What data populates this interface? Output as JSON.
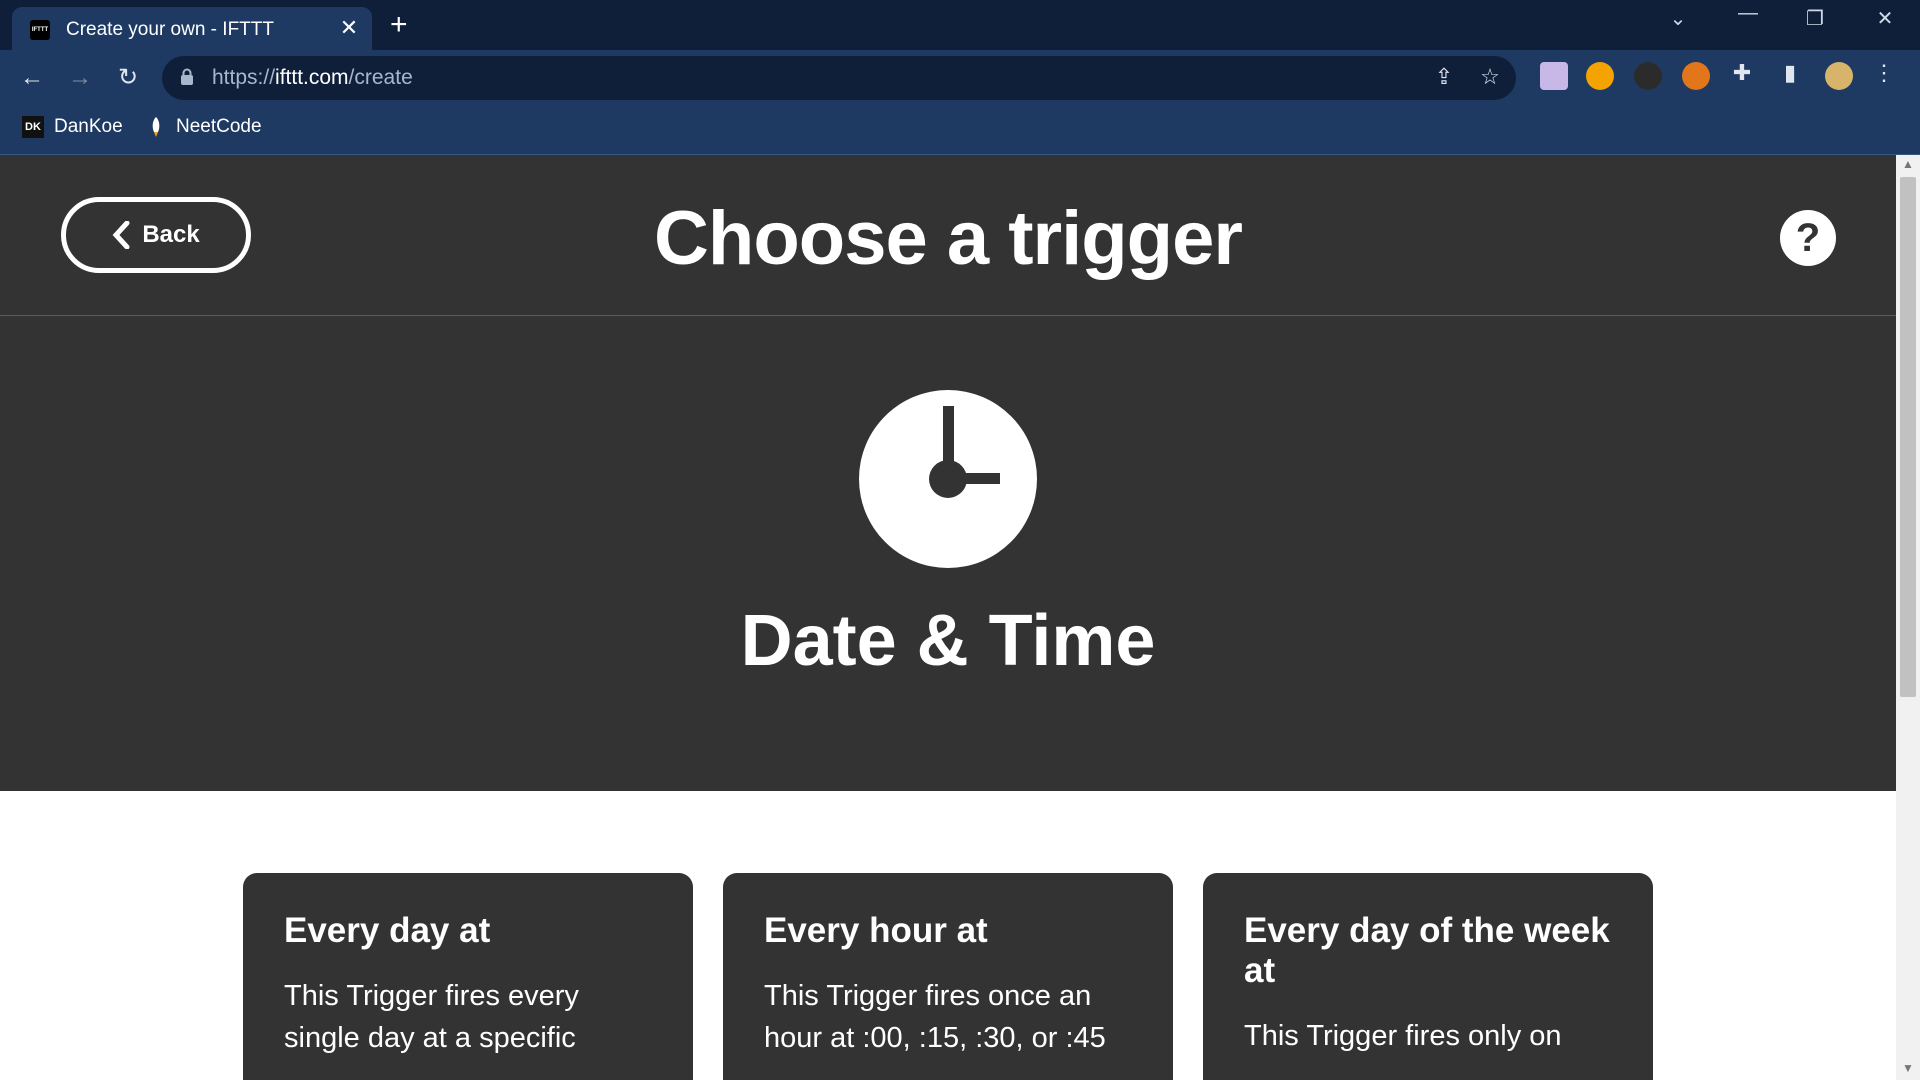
{
  "browser": {
    "tab_title": "Create your own - IFTTT",
    "tab_favicon_text": "IFTTT",
    "tab_close": "✕",
    "new_tab": "+",
    "url_scheme": "https://",
    "url_host": "ifttt.com",
    "url_path": "/create",
    "bookmarks": [
      {
        "label": "DanKoe",
        "icon_text": "DK"
      },
      {
        "label": "NeetCode",
        "icon_text": ""
      }
    ]
  },
  "page": {
    "back_label": "Back",
    "title": "Choose a trigger",
    "help_symbol": "?",
    "service_name": "Date & Time",
    "triggers": [
      {
        "title": "Every day at",
        "description": "This Trigger fires every single day at a specific"
      },
      {
        "title": "Every hour at",
        "description": "This Trigger fires once an hour at :00, :15, :30, or :45"
      },
      {
        "title": "Every day of the week at",
        "description": "This Trigger fires only on"
      }
    ]
  },
  "colors": {
    "browser_dark": "#0f1f3a",
    "browser_light": "#1e3a63",
    "hero_bg": "#333333",
    "card_bg": "#333333"
  }
}
